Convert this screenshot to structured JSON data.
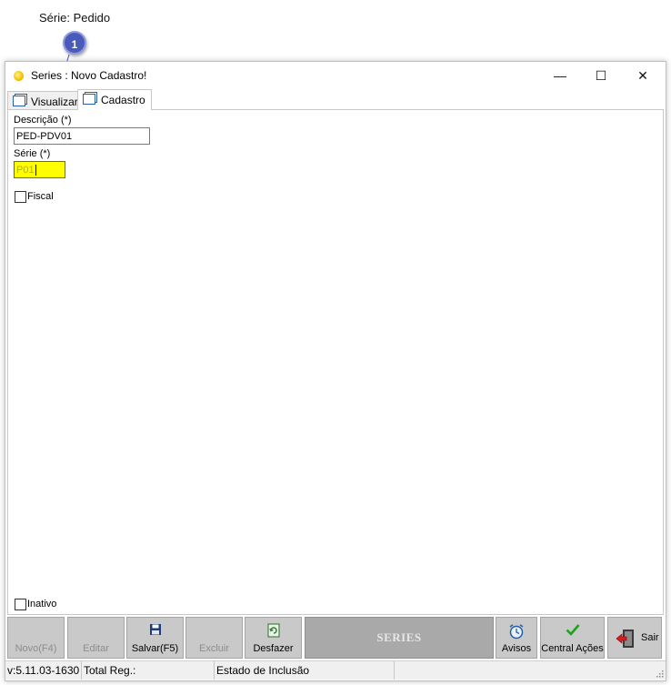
{
  "annotation": {
    "caption": "Série: Pedido",
    "callout_number": "1"
  },
  "window": {
    "title": "Series : Novo Cadastro!",
    "controls": {
      "minimize": "—",
      "maximize": "☐",
      "close": "✕"
    }
  },
  "tabs": [
    {
      "label": "Visualizar",
      "icon": "window-icon",
      "active": false
    },
    {
      "label": "Cadastro",
      "icon": "window-icon",
      "active": true
    }
  ],
  "form": {
    "descricao": {
      "label": "Descrição (*)",
      "value": "PED-PDV01"
    },
    "serie": {
      "label": "Série (*)",
      "value": "P01"
    },
    "fiscal": {
      "label": "Fiscal",
      "checked": false
    },
    "inativo": {
      "label": "Inativo",
      "checked": false
    }
  },
  "toolbar": {
    "novo": {
      "label": "Novo(F4)",
      "enabled": false
    },
    "editar": {
      "label": "Editar",
      "enabled": false
    },
    "salvar": {
      "label": "Salvar(F5)",
      "icon": "floppy-disk-icon",
      "enabled": true
    },
    "excluir": {
      "label": "Excluir",
      "enabled": false
    },
    "desfazer": {
      "label": "Desfazer",
      "icon": "undo-document-icon",
      "enabled": true
    },
    "module_title": "SERIES",
    "avisos": {
      "label": "Avisos",
      "icon": "alarm-clock-icon",
      "enabled": true
    },
    "central_acoes": {
      "label": "Central Ações",
      "icon": "checkmark-icon",
      "enabled": true
    },
    "sair": {
      "label": "Sair",
      "icon": "exit-door-icon",
      "enabled": true
    }
  },
  "statusbar": {
    "version": "v:5.11.03-1630",
    "total_reg": "Total Reg.:",
    "estado": "Estado de Inclusão",
    "extra": ""
  },
  "colors": {
    "serie_field_bg": "#ffff00",
    "callout": "#4a5ab8",
    "toolbar_btn": "#c9c9c9",
    "series_bar": "#a9a9a9"
  }
}
